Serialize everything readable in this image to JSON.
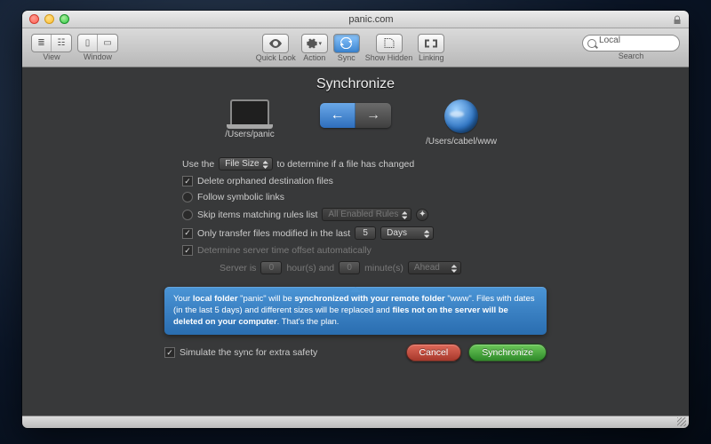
{
  "window": {
    "title": "panic.com"
  },
  "toolbar": {
    "groups": {
      "view": "View",
      "window": "Window",
      "quicklook": "Quick Look",
      "action": "Action",
      "sync": "Sync",
      "showhidden": "Show Hidden",
      "linking": "Linking",
      "search": "Search"
    }
  },
  "search": {
    "value": "Local"
  },
  "sync": {
    "title": "Synchronize",
    "local_path": "/Users/panic",
    "remote_path": "/Users/cabel/www",
    "use_the": "Use the",
    "determine_method": "File Size",
    "determine_suffix": "to determine if a file has changed",
    "delete_orphaned": "Delete orphaned destination files",
    "follow_symlinks": "Follow symbolic links",
    "skip_rules": "Skip items matching rules list",
    "rules_value": "All Enabled Rules",
    "only_transfer": "Only transfer files modified in the last",
    "only_transfer_num": "5",
    "only_transfer_unit": "Days",
    "determine_offset": "Determine server time offset automatically",
    "server_is": "Server is",
    "hours_val": "0",
    "hours_lbl": "hour(s) and",
    "minutes_val": "0",
    "minutes_lbl": "minute(s)",
    "offset_dir": "Ahead",
    "info_1": "Your ",
    "info_2": "local folder",
    "info_3": " \"panic\" will be ",
    "info_4": "synchronized with your remote folder",
    "info_5": " \"www\". Files with dates (in the last 5 days) and different sizes will be replaced and ",
    "info_6": "files not on the server will be deleted on your computer",
    "info_7": ". That's the plan.",
    "simulate": "Simulate the sync for extra safety",
    "cancel": "Cancel",
    "go": "Synchronize"
  }
}
